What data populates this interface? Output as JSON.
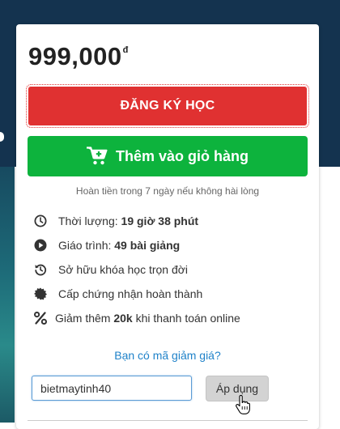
{
  "price": {
    "amount": "999,000",
    "currency": "đ"
  },
  "buttons": {
    "register_label": "ĐĂNG KÝ HỌC",
    "cart_label": "Thêm vào giỏ hàng",
    "apply_label": "Áp dụng"
  },
  "refund_note": "Hoàn tiền trong 7 ngày nếu không hài lòng",
  "features": [
    {
      "icon": "clock-icon",
      "prefix": "Thời lượng: ",
      "strong": "19 giờ 38 phút",
      "suffix": ""
    },
    {
      "icon": "play-circle-icon",
      "prefix": "Giáo trình: ",
      "strong": "49 bài giảng",
      "suffix": ""
    },
    {
      "icon": "history-icon",
      "prefix": "Sở hữu khóa học trọn đời",
      "strong": "",
      "suffix": ""
    },
    {
      "icon": "certificate-icon",
      "prefix": "Cấp chứng nhận hoàn thành",
      "strong": "",
      "suffix": ""
    },
    {
      "icon": "percent-icon",
      "prefix": "Giảm thêm ",
      "strong": "20k",
      "suffix": " khi thanh toán online"
    }
  ],
  "coupon": {
    "link_label": "Bạn có mã giảm giá?",
    "input_value": "bietmaytinh40"
  },
  "colors": {
    "register": "#e03131",
    "cart": "#0db33d",
    "link": "#1f82c9"
  }
}
